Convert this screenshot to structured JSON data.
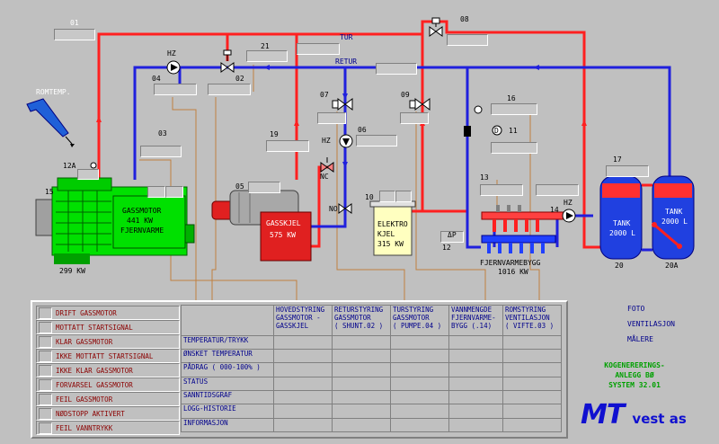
{
  "labels": {
    "n01": "01",
    "n02": "02",
    "n03": "03",
    "n04": "04",
    "n05": "05",
    "n06": "06",
    "n07": "07",
    "n08": "08",
    "n09": "09",
    "n10": "10",
    "n11": "11",
    "n12": "12",
    "n12a": "12A",
    "n13": "13",
    "n14": "14",
    "n15": "15",
    "n16": "16",
    "n17": "17",
    "n19": "19",
    "n20": "20",
    "n20a": "20A",
    "n21": "21",
    "tur": "TUR",
    "retur": "RETUR",
    "romtemp": "ROMTEMP.",
    "hz": "HZ",
    "nc": "NC",
    "no": "NO",
    "dp": "ΔP",
    "t": "T",
    "d": "D",
    "gassmotor": "GASSMOTOR",
    "kw441": "441 KW",
    "fjernvarme": "FJERNVARME",
    "kw299": "299 KW",
    "gasskjel": "GASSKJEL",
    "kw575": "575 KW",
    "elektro": "ELEKTRO",
    "kjel": "KJEL",
    "kw315": "315 KW",
    "fjernvarmebygg": "FJERNVARMEBYGG",
    "kw1016": "1016 KW",
    "tank": "TANK",
    "tank2000": "2000 L"
  },
  "alarms": [
    "DRIFT GASSMOTOR",
    "MOTTATT STARTSIGNAL",
    "KLAR GASSMOTOR",
    "IKKE MOTTATT STARTSIGNAL",
    "IKKE KLAR GASSMOTOR",
    "FORVARSEL GASSMOTOR",
    "FEIL GASSMOTOR",
    "NØDSTOPP AKTIVERT",
    "FEIL VANNTRYKK"
  ],
  "grid": {
    "columns": [
      [
        "HOVEDSTYRING",
        "GASSMOTOR -",
        "GASSKJEL"
      ],
      [
        "RETURSTYRING",
        "GASSMOTOR",
        "( SHUNT.02 )"
      ],
      [
        "TURSTYRING",
        "GASSMOTOR",
        "( PUMPE.04 )"
      ],
      [
        "VANNMENGDE",
        "FJERNVARME-",
        "BYGG (.14)"
      ],
      [
        "ROMSTYRING",
        "VENTILASJON",
        "( VIFTE.03 )"
      ]
    ],
    "rows": [
      "TEMPERATUR/TRYKK",
      "ØNSKET TEMPERATUR",
      "PÅDRAG ( 000-100% )",
      "STATUS",
      "SANNTIDSGRAF",
      "LOGG-HISTORIE",
      "INFORMASJON"
    ]
  },
  "right_links": [
    "FOTO",
    "VENTILASJON",
    "MÅLERE"
  ],
  "plant": {
    "line1": "KOGENERERINGS-",
    "line2": "ANLEGG BØ",
    "line3": "SYSTEM 32.01"
  },
  "logo": {
    "mt": "MT",
    "vest": "vest as"
  },
  "colors": {
    "supply": "#ff2020",
    "return": "#2020dd",
    "engine": "#00e000",
    "boiler": "#e02020",
    "thread": "#c08040"
  }
}
